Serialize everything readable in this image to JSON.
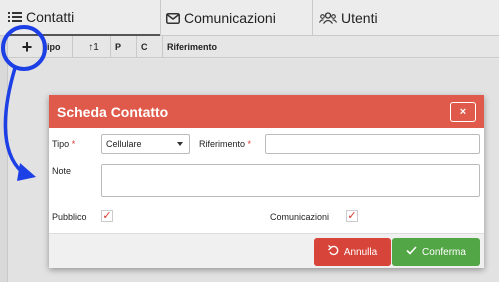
{
  "tabs": [
    {
      "label": "Contatti",
      "icon": "list-icon"
    },
    {
      "label": "Comunicazioni",
      "icon": "envelope-icon"
    },
    {
      "label": "Utenti",
      "icon": "users-icon"
    }
  ],
  "table": {
    "add_label": "+",
    "columns": [
      "ipo",
      "↑1",
      "P",
      "C",
      "Riferimento"
    ]
  },
  "modal": {
    "title": "Scheda Contatto",
    "close_label": "×",
    "tipo_label": "Tipo",
    "tipo_value": "Cellulare",
    "riferimento_label": "Riferimento",
    "riferimento_value": "",
    "note_label": "Note",
    "note_value": "",
    "pubblico_label": "Pubblico",
    "pubblico_checked": true,
    "comunicazioni_label": "Comunicazioni",
    "comunicazioni_checked": true,
    "required_mark": "*",
    "check_mark": "✓",
    "annulla_label": "Annulla",
    "conferma_label": "Conferma"
  },
  "colors": {
    "header_red": "#e05a4b",
    "annulla_red": "#d7443a",
    "conferma_green": "#52a646",
    "annotation_blue": "#1d3fe6"
  }
}
